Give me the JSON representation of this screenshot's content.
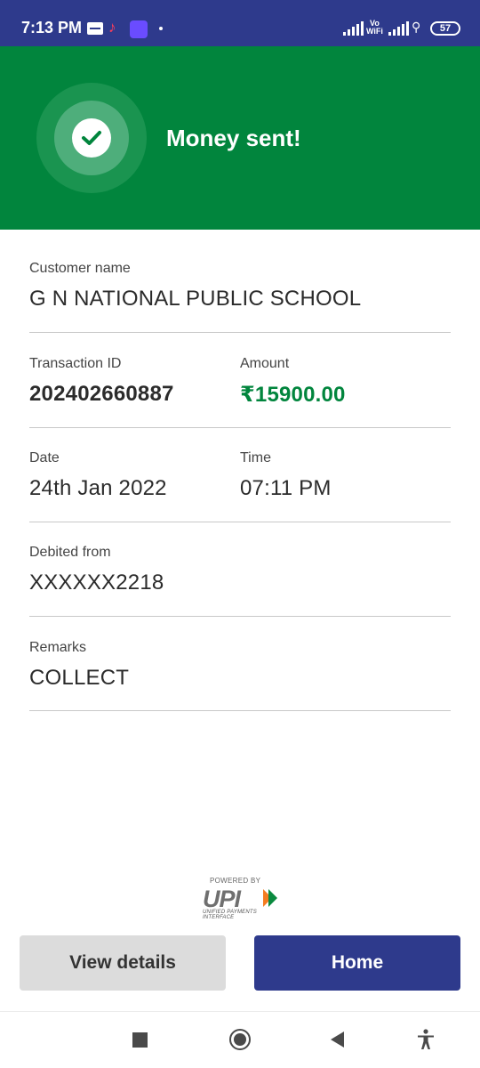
{
  "status_bar": {
    "time": "7:13 PM",
    "vowifi_top": "Vo",
    "vowifi_bottom": "WiFi",
    "battery": "57",
    "icons": [
      "message-icon",
      "tiktok-icon",
      "app-icon",
      "signal-icon",
      "vowifi-icon",
      "hotspot-icon",
      "battery-icon"
    ]
  },
  "header": {
    "title": "Money sent!",
    "background_color": "#01853d",
    "icon": "check-circle-icon"
  },
  "details": {
    "customer": {
      "label": "Customer name",
      "value": "G N NATIONAL PUBLIC SCHOOL"
    },
    "transaction_id": {
      "label": "Transaction ID",
      "value": "202402660887"
    },
    "amount": {
      "label": "Amount",
      "value": "₹15900.00",
      "color": "#01853d"
    },
    "date": {
      "label": "Date",
      "value": "24th Jan 2022"
    },
    "time": {
      "label": "Time",
      "value": "07:11 PM"
    },
    "debited_from": {
      "label": "Debited from",
      "value": "XXXXXX2218"
    },
    "remarks": {
      "label": "Remarks",
      "value": "COLLECT"
    }
  },
  "upi_logo": {
    "powered_by": "POWERED BY",
    "mark": "UPI",
    "subtitle": "UNIFIED PAYMENTS INTERFACE"
  },
  "buttons": {
    "view_details": "View details",
    "home": "Home",
    "primary_color": "#2e3a8c"
  },
  "nav_bar": {
    "icons": [
      "recent-apps-icon",
      "home-circle-icon",
      "back-icon",
      "accessibility-icon"
    ]
  }
}
